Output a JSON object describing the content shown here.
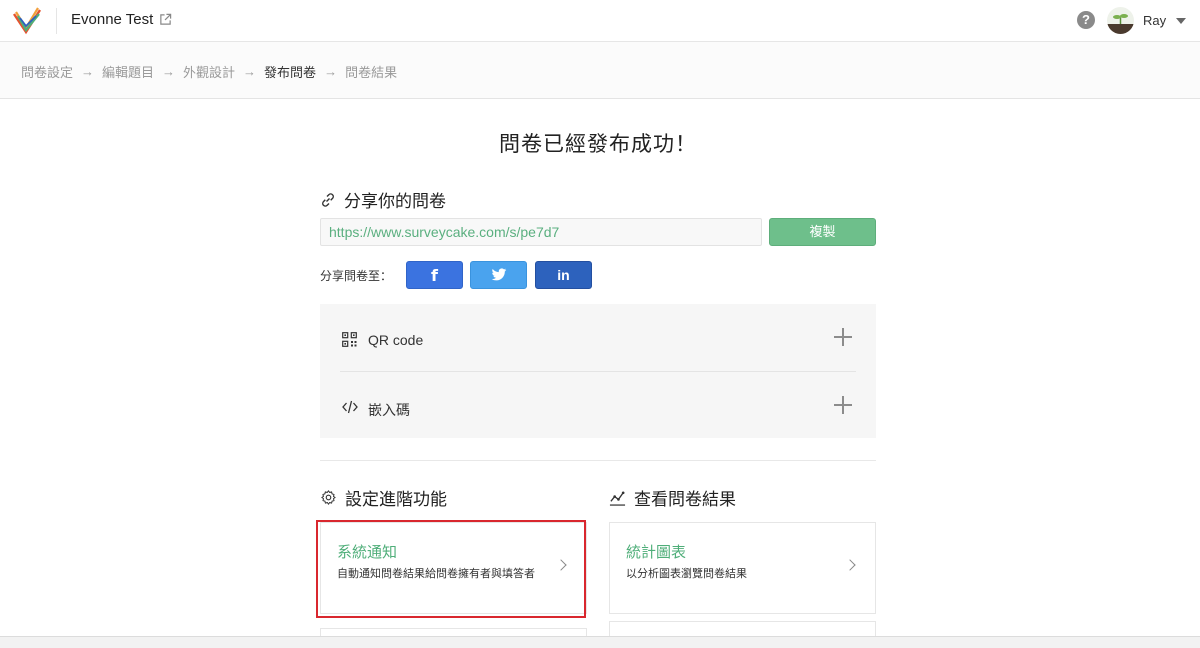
{
  "header": {
    "project_title": "Evonne Test",
    "user_name": "Ray",
    "help_glyph": "?"
  },
  "breadcrumb": {
    "steps": [
      "問卷設定",
      "編輯題目",
      "外觀設計",
      "發布問卷",
      "問卷結果"
    ],
    "active_index": 3,
    "arrow": "→"
  },
  "main": {
    "headline": "問卷已經發布成功！",
    "share_title": "分享你的問卷",
    "survey_url": "https://www.surveycake.com/s/pe7d7",
    "copy_label": "複製",
    "share_to_label": "分享問卷至：",
    "social": {
      "facebook_glyph": "f",
      "linkedin_glyph": "in"
    },
    "accordion": [
      {
        "label": "QR code",
        "icon": "qr-code-icon"
      },
      {
        "label": "嵌入碼",
        "icon": "code-icon"
      }
    ],
    "advanced_title": "設定進階功能",
    "results_title": "查看問卷結果",
    "advanced_cards": [
      {
        "title": "系統通知",
        "desc": "自動通知問卷結果給問卷擁有者與填答者"
      }
    ],
    "results_cards": [
      {
        "title": "統計圖表",
        "desc": "以分析圖表瀏覽問卷結果"
      }
    ]
  },
  "colors": {
    "accent_green": "#6ebf8b",
    "link_green": "#4fae79",
    "facebook": "#3b73e0",
    "twitter": "#4aa3ee",
    "linkedin": "#2d62bd",
    "highlight_red": "#d9272e"
  }
}
